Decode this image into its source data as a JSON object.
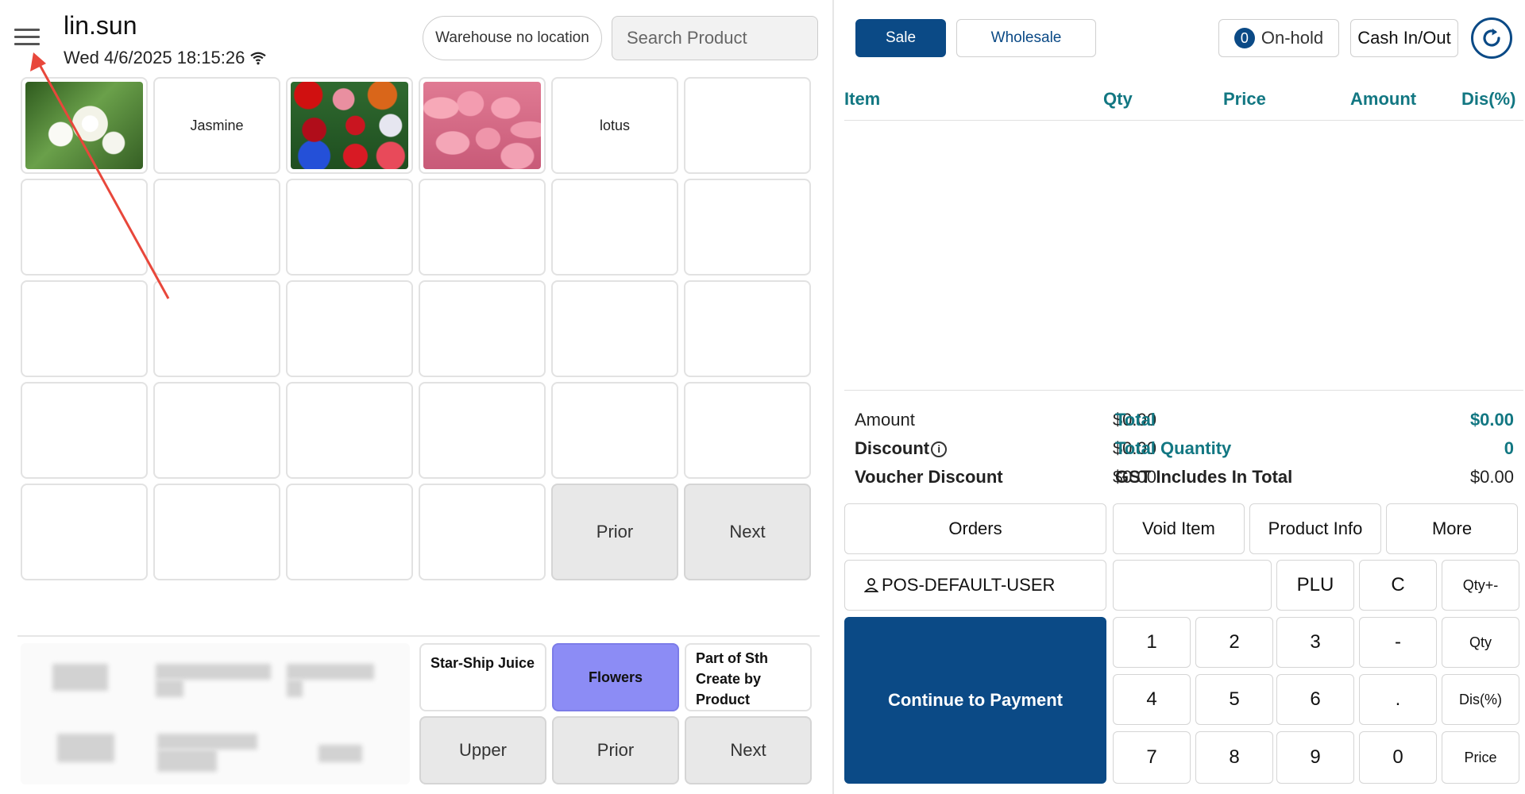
{
  "header": {
    "user_name": "lin.sun",
    "datetime": "Wed 4/6/2025 18:15:26",
    "warehouse_label": "Warehouse no location",
    "search_placeholder": "Search Product"
  },
  "products": {
    "tiles": [
      {
        "label": "",
        "image": "lily-image"
      },
      {
        "label": "Jasmine",
        "image": ""
      },
      {
        "label": "",
        "image": "roses-collage-image"
      },
      {
        "label": "",
        "image": "tulips-image"
      },
      {
        "label": "lotus",
        "image": ""
      }
    ],
    "prior_label": "Prior",
    "next_label": "Next"
  },
  "categories": {
    "items": [
      "Star-Ship Juice",
      "Flowers",
      "Part of Sth Create by Product"
    ],
    "active": "Flowers",
    "upper_label": "Upper",
    "prior_label": "Prior",
    "next_label": "Next"
  },
  "modes": {
    "sale_label": "Sale",
    "wholesale_label": "Wholesale",
    "onhold_count": "0",
    "onhold_label": "On-hold",
    "cash_label": "Cash In/Out"
  },
  "cart": {
    "columns": [
      "Item",
      "Qty",
      "Price",
      "Amount",
      "Dis(%)"
    ],
    "rows": []
  },
  "summary": {
    "amount_label": "Amount",
    "amount_value": "$0.00",
    "discount_label": "Discount",
    "discount_value": "$0.00",
    "voucher_label": "Voucher Discount",
    "voucher_value": "$0.00",
    "total_label": "Total",
    "total_value": "$0.00",
    "total_qty_label": "Total Quantity",
    "total_qty_value": "0",
    "gst_label": "GST Includes In Total",
    "gst_value": "$0.00"
  },
  "actions": {
    "orders": "Orders",
    "void_item": "Void Item",
    "product_info": "Product Info",
    "more": "More",
    "user": "POS-DEFAULT-USER",
    "plu": "PLU",
    "clear": "C",
    "qty_pm": "Qty+-",
    "qty": "Qty",
    "dis": "Dis(%)",
    "price": "Price",
    "pay": "Continue to Payment"
  },
  "keypad": {
    "keys": [
      "1",
      "2",
      "3",
      "-",
      "4",
      "5",
      "6",
      ".",
      "7",
      "8",
      "9",
      "0"
    ]
  },
  "colors": {
    "primary": "#0b4a86",
    "accent_teal": "#127782",
    "category_active": "#8c8cf5",
    "annotation_arrow": "#e8473b"
  }
}
